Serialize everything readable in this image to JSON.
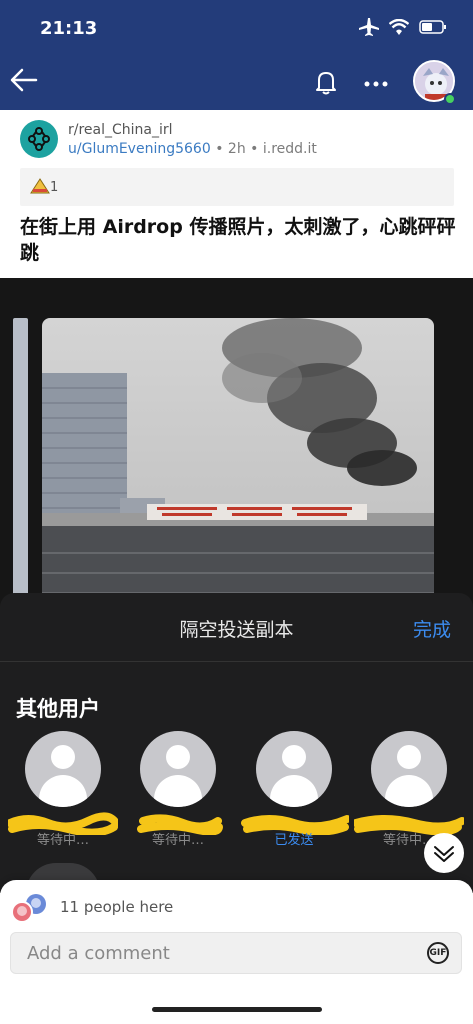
{
  "status_bar": {
    "time": "21:13"
  },
  "post": {
    "subreddit": "r/real_China_irl",
    "author": "u/GlumEvening5660",
    "age": "2h",
    "domain": "i.redd.it",
    "award_count": "1",
    "title": "在街上用 Airdrop 传播照片，太刺激了，心跳砰砰跳"
  },
  "airdrop_sheet": {
    "title": "隔空投送副本",
    "done_label": "完成",
    "section_label": "其他用户",
    "people": [
      {
        "status": "等待中…",
        "sent": false
      },
      {
        "status": "等待中…",
        "sent": false
      },
      {
        "status": "已发送",
        "sent": true
      },
      {
        "status": "等待中…",
        "sent": false
      }
    ]
  },
  "comments_bar": {
    "people_here": "11 people here",
    "placeholder": "Add a comment",
    "gif_label": "GIF"
  },
  "colors": {
    "header_bg": "#233c7a",
    "link_blue": "#3b7bc2",
    "ios_blue": "#3c8cf0",
    "scribble_yellow": "#f5c518"
  }
}
